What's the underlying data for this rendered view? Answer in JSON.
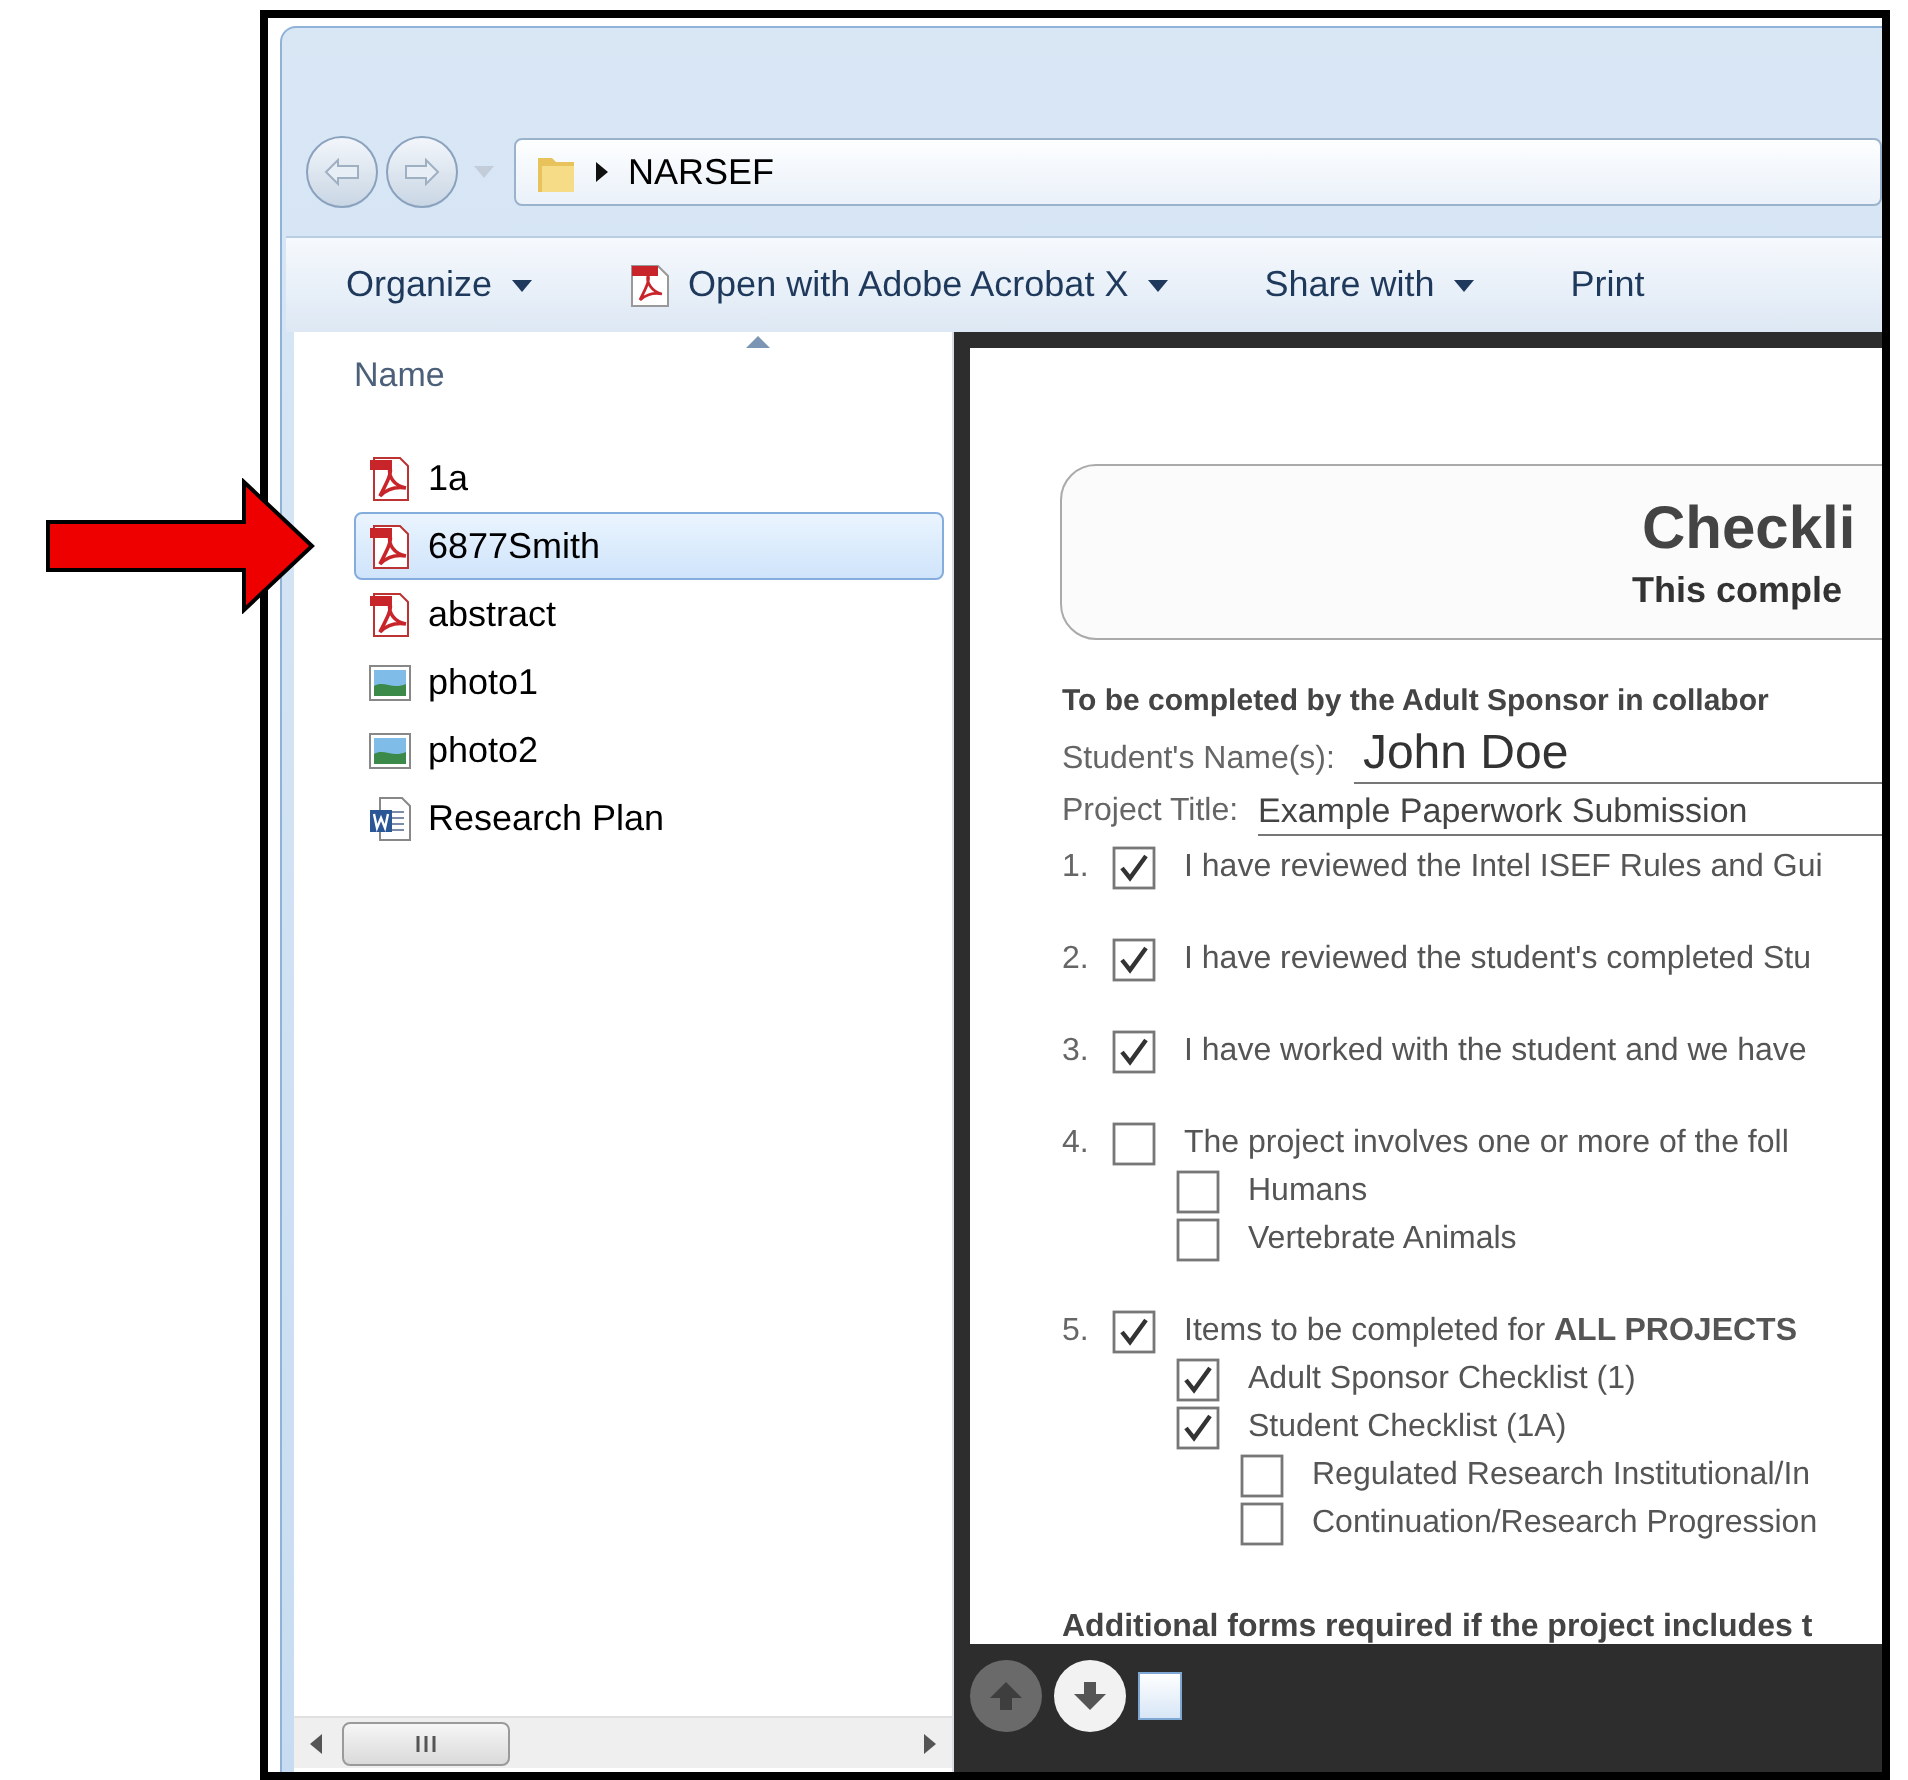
{
  "address_bar": {
    "path": [
      "NARSEF"
    ]
  },
  "toolbar": [
    {
      "label": "Organize",
      "kind": "menu"
    },
    {
      "label": "Open with Adobe Acrobat X",
      "kind": "pdf-menu"
    },
    {
      "label": "Share with",
      "kind": "menu"
    },
    {
      "label": "Print",
      "kind": "plain"
    }
  ],
  "file_list": {
    "column": "Name",
    "files": [
      {
        "name": "1a",
        "kind": "pdf",
        "selected": false
      },
      {
        "name": "6877Smith",
        "kind": "pdf",
        "selected": true
      },
      {
        "name": "abstract",
        "kind": "pdf",
        "selected": false
      },
      {
        "name": "photo1",
        "kind": "image",
        "selected": false
      },
      {
        "name": "photo2",
        "kind": "image",
        "selected": false
      },
      {
        "name": "Research Plan",
        "kind": "word",
        "selected": false
      }
    ]
  },
  "preview": {
    "title": "Checkli",
    "subtitle": "This comple",
    "intro": "To be completed by the Adult Sponsor in collabor",
    "fields": [
      {
        "label": "Student's Name(s):",
        "value": "John Doe",
        "kind": "large"
      },
      {
        "label": "Project Title:",
        "value": "Example  Paperwork  Submission",
        "kind": "small"
      }
    ],
    "items": [
      {
        "number": "1.",
        "checked": true,
        "text": "I have reviewed the Intel ISEF Rules and Gui"
      },
      {
        "number": "2.",
        "checked": true,
        "text": "I have reviewed the student's completed Stu"
      },
      {
        "number": "3.",
        "checked": true,
        "text": "I have worked with the student and we have"
      },
      {
        "number": "4.",
        "checked": false,
        "text": "The project involves one or more of the foll",
        "children": [
          {
            "checked": false,
            "text": "Humans"
          },
          {
            "checked": false,
            "text": "Vertebrate Animals"
          }
        ]
      },
      {
        "number": "5.",
        "checked": true,
        "text": "Items to be completed for **ALL PROJECTS**",
        "children": [
          {
            "checked": true,
            "text": "Adult Sponsor Checklist (1)"
          },
          {
            "checked": true,
            "text": "Student Checklist (1A)",
            "children": [
              {
                "checked": false,
                "text": "Regulated Research Institutional/In"
              },
              {
                "checked": false,
                "text": "Continuation/Research Progression"
              }
            ]
          }
        ]
      }
    ],
    "footer": "Additional forms required if the project includes t",
    "controls": [
      {
        "kind": "up",
        "disabled": true
      },
      {
        "kind": "down",
        "disabled": false
      },
      {
        "kind": "page",
        "disabled": false
      }
    ]
  }
}
